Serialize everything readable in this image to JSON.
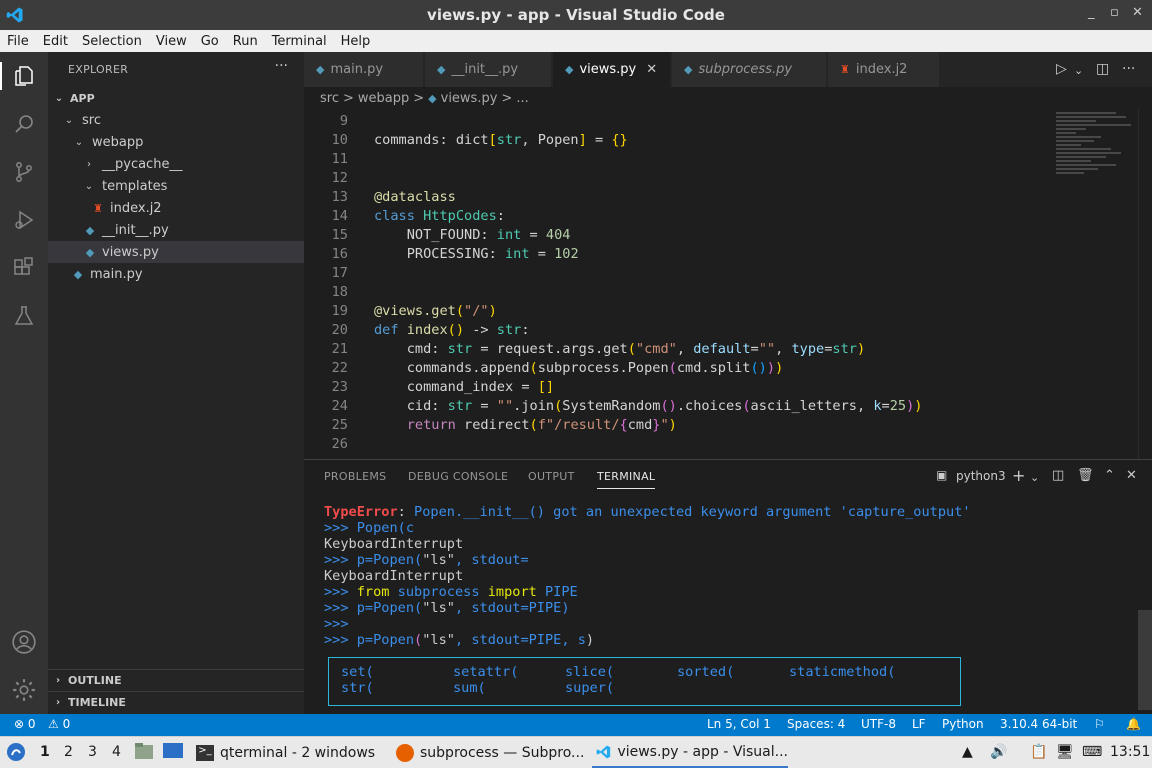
{
  "window": {
    "title": "views.py - app - Visual Studio Code",
    "min": "_",
    "max": "▫",
    "close": "✕"
  },
  "menu": [
    "File",
    "Edit",
    "Selection",
    "View",
    "Go",
    "Run",
    "Terminal",
    "Help"
  ],
  "activity_bar": [
    "explorer-icon",
    "search-icon",
    "source-control-icon",
    "run-debug-icon",
    "extensions-icon",
    "testing-icon",
    "account-icon",
    "manage-gear-icon"
  ],
  "explorer": {
    "header": "EXPLORER",
    "more": "···",
    "root": "APP",
    "tree": [
      {
        "label": "src",
        "twisty": "⌄",
        "icon": ""
      },
      {
        "label": "webapp",
        "twisty": "⌄",
        "icon": ""
      },
      {
        "label": "__pycache__",
        "twisty": "›",
        "icon": ""
      },
      {
        "label": "templates",
        "twisty": "⌄",
        "icon": ""
      },
      {
        "label": "index.j2",
        "twisty": "",
        "icon": "jinja-file-icon"
      },
      {
        "label": "__init__.py",
        "twisty": "",
        "icon": "python-file-icon"
      },
      {
        "label": "views.py",
        "twisty": "",
        "icon": "python-file-icon"
      },
      {
        "label": "main.py",
        "twisty": "",
        "icon": "python-file-icon"
      }
    ],
    "outline": "OUTLINE",
    "timeline": "TIMELINE"
  },
  "tabs": [
    {
      "label": "main.py",
      "icon": "python-file-icon"
    },
    {
      "label": "__init__.py",
      "icon": "python-file-icon"
    },
    {
      "label": "views.py",
      "icon": "python-file-icon",
      "close": "✕"
    },
    {
      "label": "subprocess.py",
      "icon": "python-file-icon"
    },
    {
      "label": "index.j2",
      "icon": "jinja-file-icon"
    }
  ],
  "breadcrumb": [
    "src",
    ">",
    "webapp",
    ">",
    "views.py",
    ">",
    "..."
  ],
  "editor": {
    "lines": [
      {
        "n": "9",
        "segs": []
      },
      {
        "n": "10",
        "segs": [
          [
            "",
            "commands: dict"
          ],
          [
            "br1",
            "["
          ],
          [
            "ty",
            "str"
          ],
          [
            "",
            ", Popen"
          ],
          [
            "br1",
            "]"
          ],
          [
            "",
            " = "
          ],
          [
            "br1",
            "{}"
          ]
        ]
      },
      {
        "n": "11",
        "segs": []
      },
      {
        "n": "12",
        "segs": []
      },
      {
        "n": "13",
        "segs": [
          [
            "dec",
            "@dataclass"
          ]
        ]
      },
      {
        "n": "14",
        "segs": [
          [
            "kw",
            "class "
          ],
          [
            "ty",
            "HttpCodes"
          ],
          [
            "",
            ":"
          ]
        ]
      },
      {
        "n": "15",
        "segs": [
          [
            "",
            "    NOT_FOUND: "
          ],
          [
            "ty",
            "int"
          ],
          [
            "",
            " = "
          ],
          [
            "nu",
            "404"
          ]
        ]
      },
      {
        "n": "16",
        "segs": [
          [
            "",
            "    PROCESSING: "
          ],
          [
            "ty",
            "int"
          ],
          [
            "",
            " = "
          ],
          [
            "nu",
            "102"
          ]
        ]
      },
      {
        "n": "17",
        "segs": []
      },
      {
        "n": "18",
        "segs": []
      },
      {
        "n": "19",
        "segs": [
          [
            "dec",
            "@views.get"
          ],
          [
            "br1",
            "("
          ],
          [
            "st",
            "\"/\""
          ],
          [
            "br1",
            ")"
          ]
        ]
      },
      {
        "n": "20",
        "segs": [
          [
            "kw",
            "def "
          ],
          [
            "fn",
            "index"
          ],
          [
            "br1",
            "()"
          ],
          [
            "",
            " -> "
          ],
          [
            "ty",
            "str"
          ],
          [
            "",
            ":"
          ]
        ]
      },
      {
        "n": "21",
        "segs": [
          [
            "",
            "    cmd: "
          ],
          [
            "ty",
            "str"
          ],
          [
            "",
            " = request.args.get"
          ],
          [
            "br1",
            "("
          ],
          [
            "st",
            "\"cmd\""
          ],
          [
            "",
            ", "
          ],
          [
            "pa",
            "default"
          ],
          [
            "",
            "="
          ],
          [
            "st",
            "\"\""
          ],
          [
            "",
            ", "
          ],
          [
            "pa",
            "type"
          ],
          [
            "",
            "="
          ],
          [
            "ty",
            "str"
          ],
          [
            "br1",
            ")"
          ]
        ]
      },
      {
        "n": "22",
        "segs": [
          [
            "",
            "    commands.append"
          ],
          [
            "br1",
            "("
          ],
          [
            "",
            "subprocess.Popen"
          ],
          [
            "br2",
            "("
          ],
          [
            "",
            "cmd.split"
          ],
          [
            "br3",
            "()"
          ],
          [
            "br2",
            ")"
          ],
          [
            "br1",
            ")"
          ]
        ]
      },
      {
        "n": "23",
        "segs": [
          [
            "",
            "    command_index = "
          ],
          [
            "br1",
            "[]"
          ]
        ]
      },
      {
        "n": "24",
        "segs": [
          [
            "",
            "    cid: "
          ],
          [
            "ty",
            "str"
          ],
          [
            "",
            " = "
          ],
          [
            "st",
            "\"\""
          ],
          [
            "",
            ".join"
          ],
          [
            "br1",
            "("
          ],
          [
            "",
            "SystemRandom"
          ],
          [
            "br2",
            "()"
          ],
          [
            "",
            ".choices"
          ],
          [
            "br2",
            "("
          ],
          [
            "",
            "ascii_letters, "
          ],
          [
            "pa",
            "k"
          ],
          [
            "",
            "="
          ],
          [
            "nu",
            "25"
          ],
          [
            "br2",
            ")"
          ],
          [
            "br1",
            ")"
          ]
        ]
      },
      {
        "n": "25",
        "segs": [
          [
            "ctl",
            "    return "
          ],
          [
            "",
            "redirect"
          ],
          [
            "br1",
            "("
          ],
          [
            "st",
            "f\"/result/"
          ],
          [
            "br2",
            "{"
          ],
          [
            "",
            "cmd"
          ],
          [
            "br2",
            "}"
          ],
          [
            "st",
            "\""
          ],
          [
            "br1",
            ")"
          ]
        ]
      },
      {
        "n": "26",
        "segs": []
      }
    ]
  },
  "panel": {
    "tabs": [
      "PROBLEMS",
      "DEBUG CONSOLE",
      "OUTPUT",
      "TERMINAL"
    ],
    "terminal_name": "python3",
    "lines": [
      [
        [
          "t-red",
          "TypeError"
        ],
        [
          "t-def",
          ": "
        ],
        [
          "t-blu",
          "Popen.__init__() got an unexpected keyword argument 'capture_output'"
        ]
      ],
      [
        [
          "t-blu",
          ">>> Popen(c"
        ]
      ],
      [
        [
          "t-def",
          "KeyboardInterrupt"
        ]
      ],
      [
        [
          "t-blu",
          ">>> p=Popen("
        ],
        [
          "t-def",
          "\"ls\""
        ],
        [
          "t-blu",
          ", stdout="
        ]
      ],
      [
        [
          "t-def",
          "KeyboardInterrupt"
        ]
      ],
      [
        [
          "t-blu",
          ">>> "
        ],
        [
          "t-yel",
          "from "
        ],
        [
          "t-blu",
          "subprocess "
        ],
        [
          "t-yel",
          "import "
        ],
        [
          "t-blu",
          "PIPE"
        ]
      ],
      [
        [
          "t-blu",
          ">>> p=Popen("
        ],
        [
          "t-def",
          "\"ls\""
        ],
        [
          "t-blu",
          ", stdout=PIPE)"
        ]
      ],
      [
        [
          "t-blu",
          ">>>"
        ]
      ],
      [
        [
          "t-blu",
          ">>> p=Popen"
        ],
        [
          "t-mag",
          "("
        ],
        [
          "t-def",
          "\"ls\""
        ],
        [
          "t-blu",
          ", stdout=PIPE, s"
        ],
        [
          "t-def",
          ")"
        ]
      ]
    ],
    "completions": [
      [
        "set(",
        "setattr(",
        "slice(",
        "sorted(",
        "staticmethod("
      ],
      [
        "str(",
        "sum(",
        "super("
      ]
    ]
  },
  "statusbar": {
    "errors": "⊗ 0",
    "warnings": "⚠ 0",
    "position": "Ln 5, Col 1",
    "spaces": "Spaces: 4",
    "encoding": "UTF-8",
    "eol": "LF",
    "language": "Python",
    "interpreter": "3.10.4 64-bit"
  },
  "taskbar": {
    "desktops": [
      "1",
      "2",
      "3",
      "4"
    ],
    "tasks": [
      {
        "label": "qterminal - 2 windows",
        "icon": "terminal-icon"
      },
      {
        "label": "subprocess — Subpro...",
        "icon": "firefox-icon"
      },
      {
        "label": "views.py - app - Visual...",
        "icon": "vscode-icon"
      }
    ],
    "clock": "13:51"
  },
  "colors": {
    "accent": "#007acc",
    "titlebar": "#3c3c3c",
    "sidebar": "#252526",
    "editor_bg": "#1e1e1e"
  }
}
